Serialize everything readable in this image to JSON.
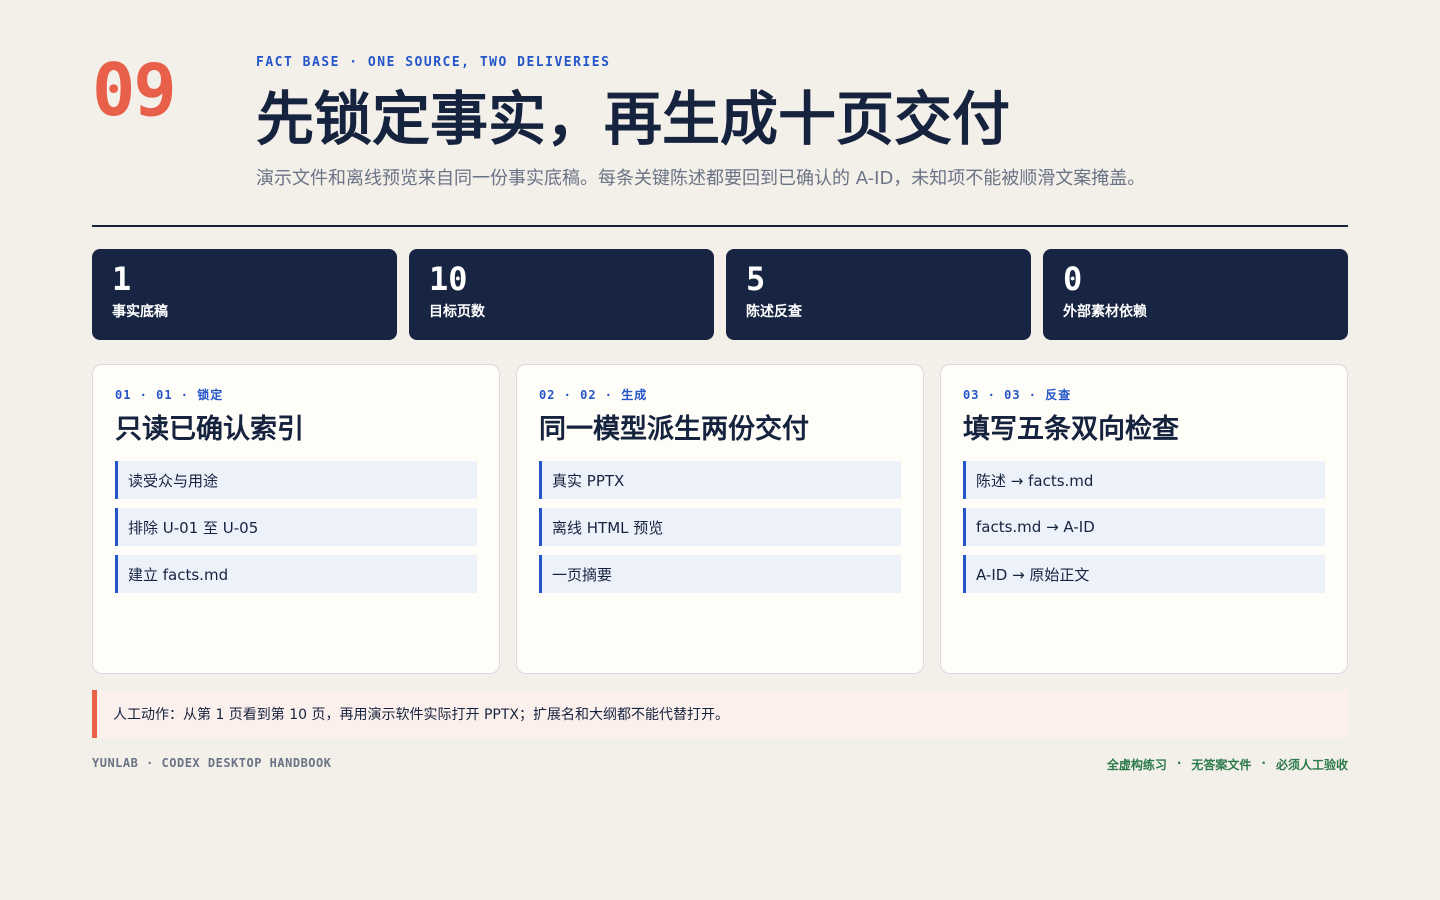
{
  "page_number": "09",
  "kicker": "FACT BASE · ONE SOURCE, TWO DELIVERIES",
  "title": "先锁定事实，再生成十页交付",
  "subtitle": "演示文件和离线预览来自同一份事实底稿。每条关键陈述都要回到已确认的 A-ID，未知项不能被顺滑文案掩盖。",
  "stats": [
    {
      "value": "1",
      "label": "事实底稿"
    },
    {
      "value": "10",
      "label": "目标页数"
    },
    {
      "value": "5",
      "label": "陈述反查"
    },
    {
      "value": "0",
      "label": "外部素材依赖"
    }
  ],
  "cards": [
    {
      "kicker": "01 · 01 · 锁定",
      "title": "只读已确认索引",
      "items": [
        "读受众与用途",
        "排除 U-01 至 U-05",
        "建立 facts.md"
      ]
    },
    {
      "kicker": "02 · 02 · 生成",
      "title": "同一模型派生两份交付",
      "items": [
        "真实 PPTX",
        "离线 HTML 预览",
        "一页摘要"
      ]
    },
    {
      "kicker": "03 · 03 · 反查",
      "title": "填写五条双向检查",
      "items": [
        "陈述 → facts.md",
        "facts.md → A-ID",
        "A-ID → 原始正文"
      ]
    }
  ],
  "note": "人工动作：从第 1 页看到第 10 页，再用演示软件实际打开 PPTX；扩展名和大纲都不能代替打开。",
  "footer": {
    "left": "YUNLAB · CODEX DESKTOP HANDBOOK",
    "right": [
      "全虚构练习",
      "无答案文件",
      "必须人工验收"
    ],
    "separator": "·"
  },
  "colors": {
    "accent": "#e8604a",
    "brand_blue": "#2456c9",
    "navy": "#182542",
    "background": "#f3efe9",
    "footer_green": "#2b7a4a"
  }
}
